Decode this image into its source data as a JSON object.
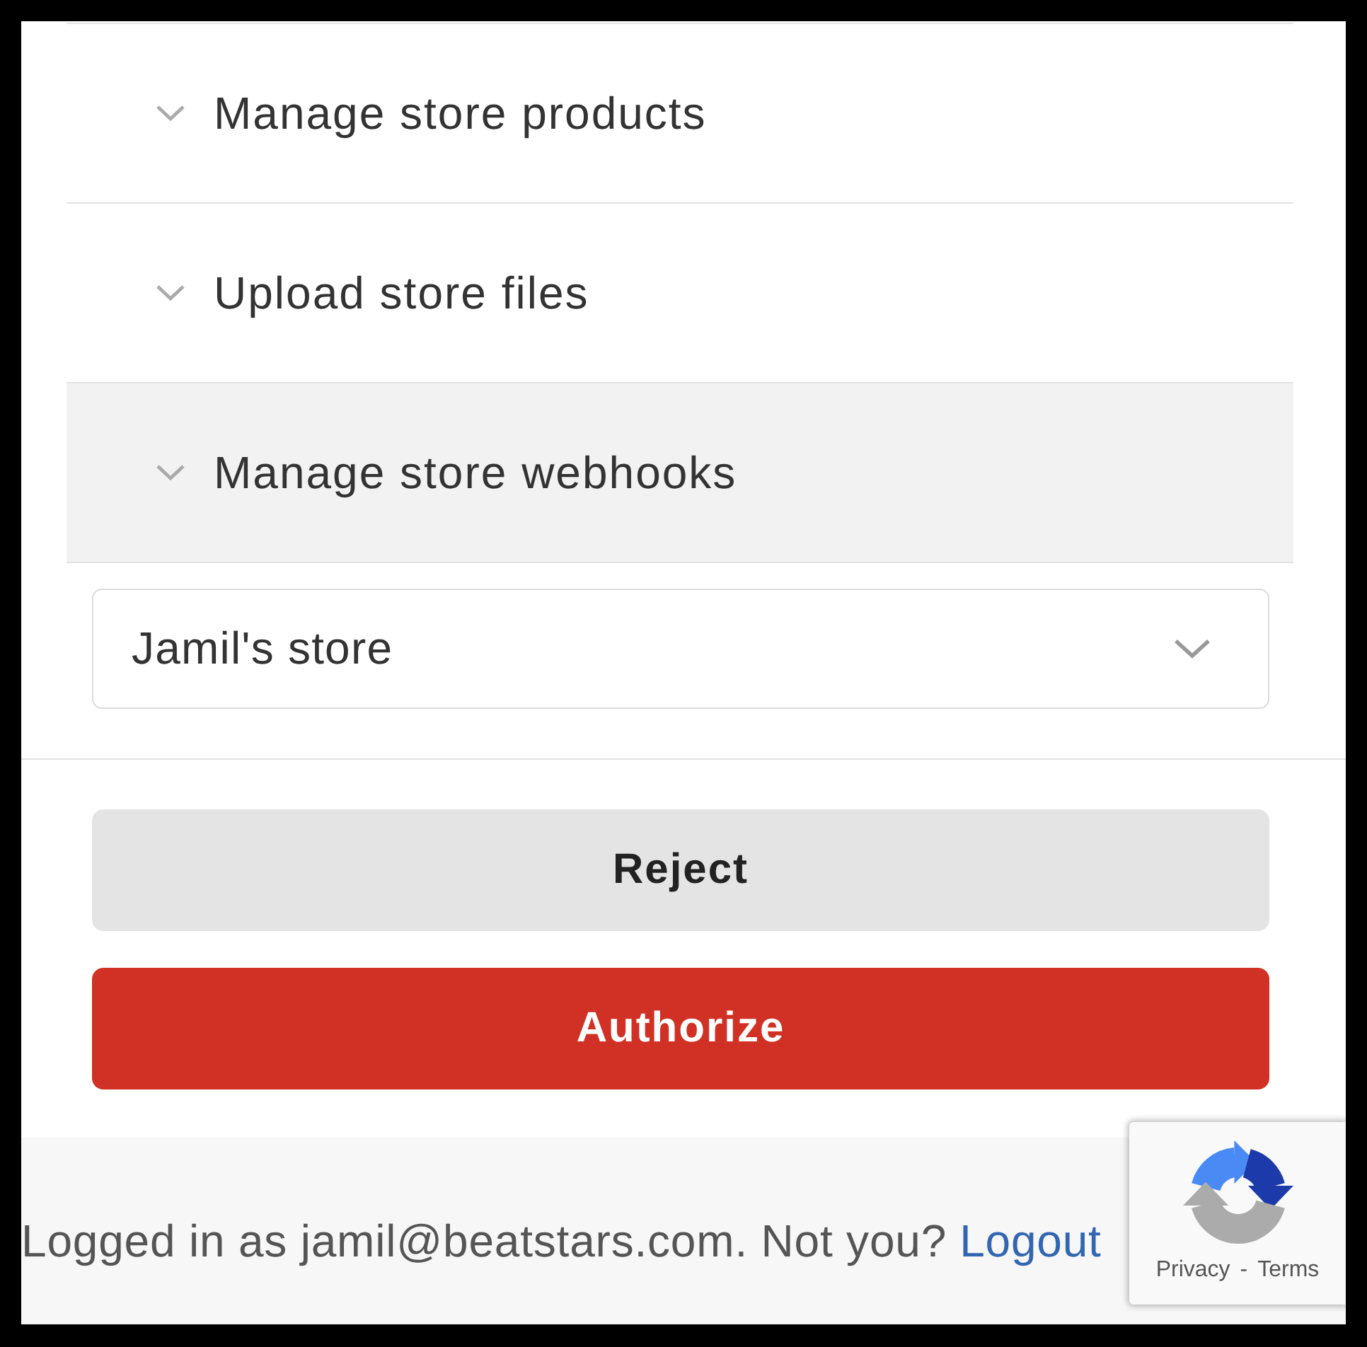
{
  "scopes": [
    {
      "label": "Manage store products",
      "highlighted": false
    },
    {
      "label": "Upload store files",
      "highlighted": false
    },
    {
      "label": "Manage store webhooks",
      "highlighted": true
    }
  ],
  "store_select": {
    "value": "Jamil's store"
  },
  "buttons": [
    {
      "label": "Reject",
      "kind": "secondary"
    },
    {
      "label": "Authorize",
      "kind": "primary"
    }
  ],
  "footer": {
    "text": "Logged in as jamil@beatstars.com. Not you?",
    "link": "Logout"
  },
  "recaptcha_badge": {
    "links": [
      "Privacy",
      "Terms"
    ],
    "separator": "-"
  }
}
